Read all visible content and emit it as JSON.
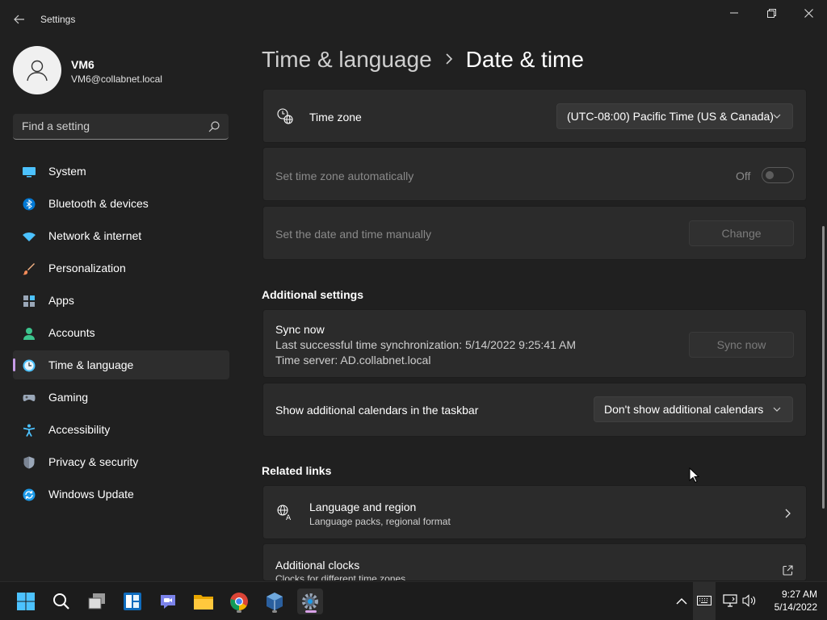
{
  "window": {
    "title": "Settings"
  },
  "profile": {
    "name": "VM6",
    "email": "VM6@collabnet.local"
  },
  "search": {
    "placeholder": "Find a setting"
  },
  "sidebar": {
    "items": [
      {
        "label": "System",
        "icon": "system-icon"
      },
      {
        "label": "Bluetooth & devices",
        "icon": "bluetooth-icon"
      },
      {
        "label": "Network & internet",
        "icon": "wifi-icon"
      },
      {
        "label": "Personalization",
        "icon": "brush-icon"
      },
      {
        "label": "Apps",
        "icon": "apps-icon"
      },
      {
        "label": "Accounts",
        "icon": "accounts-icon"
      },
      {
        "label": "Time & language",
        "icon": "time-language-icon",
        "active": true
      },
      {
        "label": "Gaming",
        "icon": "gamepad-icon"
      },
      {
        "label": "Accessibility",
        "icon": "accessibility-icon"
      },
      {
        "label": "Privacy & security",
        "icon": "shield-icon"
      },
      {
        "label": "Windows Update",
        "icon": "update-icon"
      }
    ]
  },
  "breadcrumb": {
    "parent": "Time & language",
    "separator": ">",
    "current": "Date & time"
  },
  "settings": {
    "time_zone": {
      "label": "Time zone",
      "value": "(UTC-08:00) Pacific Time (US & Canada)"
    },
    "auto_time_zone": {
      "label": "Set time zone automatically",
      "state": "Off"
    },
    "manual_time": {
      "label": "Set the date and time manually",
      "button": "Change"
    }
  },
  "additional": {
    "title": "Additional settings",
    "sync": {
      "title": "Sync now",
      "last_sync": "Last successful time synchronization: 5/14/2022 9:25:41 AM",
      "server": "Time server: AD.collabnet.local",
      "button": "Sync now"
    },
    "calendars": {
      "label": "Show additional calendars in the taskbar",
      "value": "Don't show additional calendars"
    }
  },
  "related": {
    "title": "Related links",
    "language_region": {
      "title": "Language and region",
      "subtitle": "Language packs, regional format"
    },
    "clocks": {
      "title": "Additional clocks",
      "subtitle": "Clocks for different time zones"
    }
  },
  "taskbar": {
    "apps": [
      "start-icon",
      "search-icon",
      "task-view-icon",
      "widgets-icon",
      "teams-chat-icon",
      "file-explorer-icon",
      "chrome-icon",
      "virtualbox-icon",
      "settings-icon"
    ],
    "clock_time": "9:27 AM",
    "clock_date": "5/14/2022"
  },
  "colors": {
    "accent": "#c79ce8",
    "background": "#202020",
    "card": "#2b2b2b"
  }
}
